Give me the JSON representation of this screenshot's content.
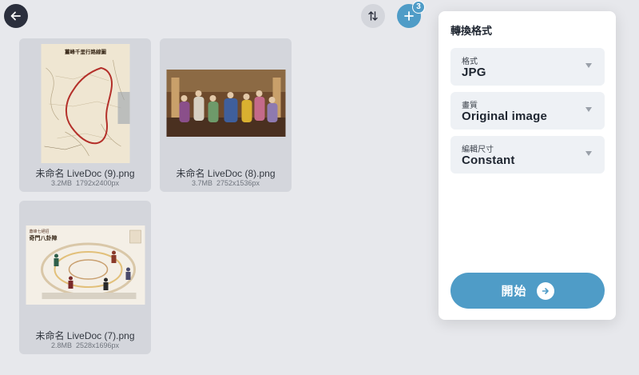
{
  "toolbar": {
    "back_icon": "arrow-left-icon",
    "sort_icon": "sort-arrows-icon",
    "add_icon": "plus-icon",
    "add_count": "3"
  },
  "files": [
    {
      "name": "未命名 LiveDoc (9).png",
      "size": "3.2MB",
      "dims": "1792x2400px",
      "thumb": "map"
    },
    {
      "name": "未命名 LiveDoc (8).png",
      "size": "3.7MB",
      "dims": "2752x1536px",
      "thumb": "painting"
    },
    {
      "name": "未命名 LiveDoc (7).png",
      "size": "2.8MB",
      "dims": "2528x1696px",
      "thumb": "diagram"
    }
  ],
  "thumb_texts": {
    "map_title": "薑峰千里行路線圖",
    "diagram_title_1": "蕭峰七絕招",
    "diagram_title_2": "奇門八卦陣"
  },
  "panel": {
    "title": "轉換格式",
    "format_label": "格式",
    "format_value": "JPG",
    "quality_label": "畫質",
    "quality_value": "Original image",
    "size_label": "編輯尺寸",
    "size_value": "Constant",
    "start_label": "開始"
  },
  "colors": {
    "accent": "#4f9cc7",
    "background": "#e7e8ec",
    "card": "#d4d6dc",
    "dark_button": "#2b2f3d"
  }
}
